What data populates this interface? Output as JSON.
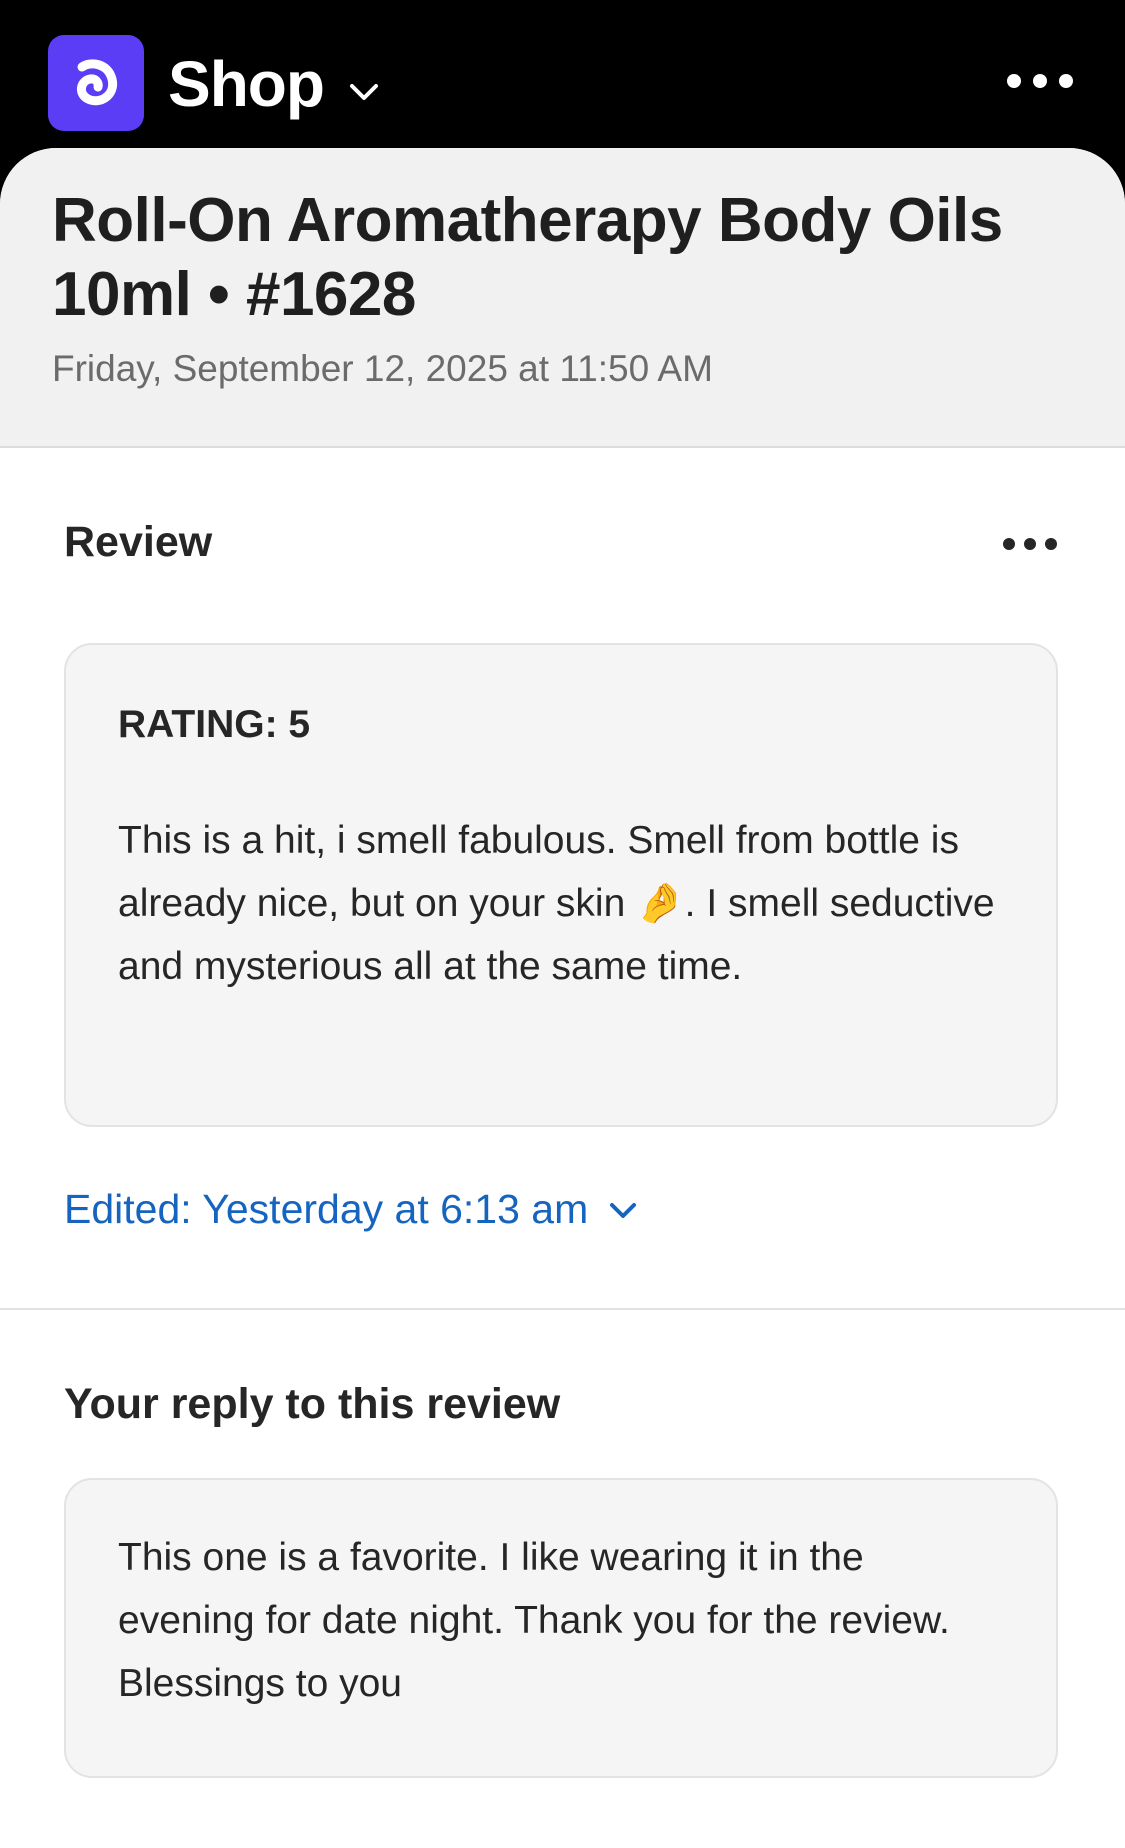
{
  "header": {
    "app_name": "Shop",
    "logo_icon": "shop-logo-icon",
    "brand_color": "#5b3df5",
    "menu_icon": "more-horizontal-icon"
  },
  "product": {
    "title": "Roll-On Aromatherapy Body Oils 10ml • #1628",
    "date": "Friday, September 12, 2025 at 11:50 AM"
  },
  "review": {
    "section_title": "Review",
    "rating_label": "RATING: 5",
    "text": "This is a hit, i smell fabulous. Smell from bottle is already nice, but on your skin 🤌. I smell seductive and mysterious all at the same time.",
    "edited": "Edited: Yesterday at 6:13 am",
    "link_color": "#1565c0"
  },
  "reply": {
    "section_title": "Your reply to this review",
    "text": "This one is a favorite. I like wearing it in the evening for date night. Thank you for the review. Blessings to you"
  }
}
